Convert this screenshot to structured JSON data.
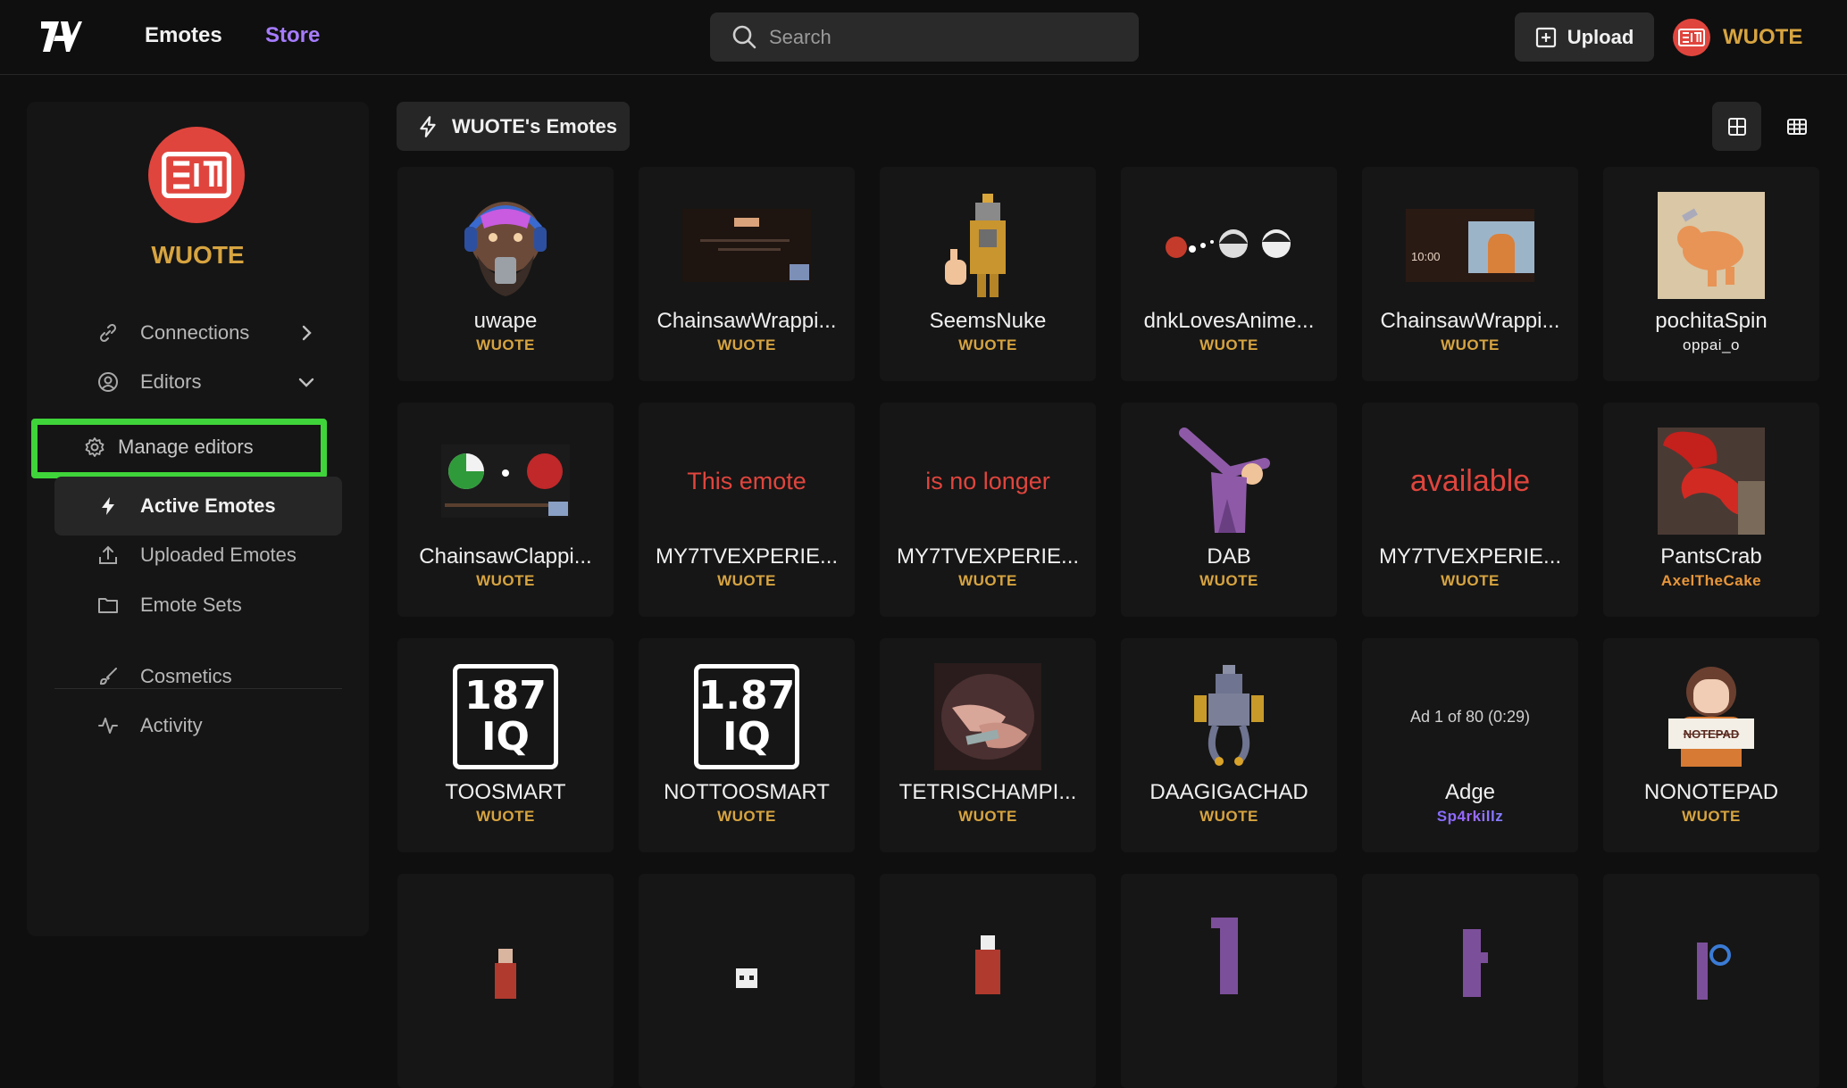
{
  "topbar": {
    "nav": {
      "emotes": "Emotes",
      "store": "Store"
    },
    "search_placeholder": "Search",
    "upload_label": "Upload",
    "username": "WUOTE"
  },
  "sidebar": {
    "username": "WUOTE",
    "items": {
      "connections": "Connections",
      "editors": "Editors",
      "manage_editors": "Manage editors",
      "active_emotes": "Active Emotes",
      "uploaded_emotes": "Uploaded Emotes",
      "emote_sets": "Emote Sets",
      "cosmetics": "Cosmetics",
      "activity": "Activity"
    }
  },
  "main": {
    "section_title": "WUOTE's Emotes",
    "emotes": [
      {
        "name": "uwape",
        "owner": "WUOTE",
        "art": "bearded-face-emote"
      },
      {
        "name": "ChainsawWrappi...",
        "owner": "WUOTE",
        "art": "video-thumbnail"
      },
      {
        "name": "SeemsNuke",
        "owner": "WUOTE",
        "art": "pixel-figure"
      },
      {
        "name": "dnkLovesAnime...",
        "owner": "WUOTE",
        "art": "anime-strip"
      },
      {
        "name": "ChainsawWrappi...",
        "owner": "WUOTE",
        "art": "video-thumbnail-timer",
        "caption": "10:00"
      },
      {
        "name": "pochitaSpin",
        "owner": "oppai_o",
        "art": "orange-dog"
      },
      {
        "name": "ChainsawClappi...",
        "owner": "WUOTE",
        "art": "pie-video"
      },
      {
        "name": "MY7TVEXPERIE...",
        "owner": "WUOTE",
        "art": "text",
        "caption": "This emote"
      },
      {
        "name": "MY7TVEXPERIE...",
        "owner": "WUOTE",
        "art": "text",
        "caption": "is no longer"
      },
      {
        "name": "DAB",
        "owner": "WUOTE",
        "art": "dab-figure"
      },
      {
        "name": "MY7TVEXPERIE...",
        "owner": "WUOTE",
        "art": "text-large",
        "caption": "available"
      },
      {
        "name": "PantsCrab",
        "owner": "AxelTheCake",
        "art": "crab-claw"
      },
      {
        "name": "TOOSMART",
        "owner": "WUOTE",
        "art": "iq-box",
        "line1": "187",
        "line2": "IQ"
      },
      {
        "name": "NOTTOOSMART",
        "owner": "WUOTE",
        "art": "iq-box",
        "line1": "1.87",
        "line2": "IQ"
      },
      {
        "name": "TETRISCHAMPI...",
        "owner": "WUOTE",
        "art": "hands-photo"
      },
      {
        "name": "DAAGIGACHAD",
        "owner": "WUOTE",
        "art": "pixel-robot"
      },
      {
        "name": "Adge",
        "owner": "Sp4rkillz",
        "art": "ad-text",
        "caption": "Ad 1 of 80 (0:29)"
      },
      {
        "name": "NONOTEPAD",
        "owner": "WUOTE",
        "art": "anime-sign",
        "caption": "NOTEPAD"
      }
    ]
  },
  "colors": {
    "accent_purple": "#a67cff",
    "owner_gold": "#d7a440",
    "avatar_red": "#e0453d",
    "highlight_green": "#3fd43a"
  }
}
